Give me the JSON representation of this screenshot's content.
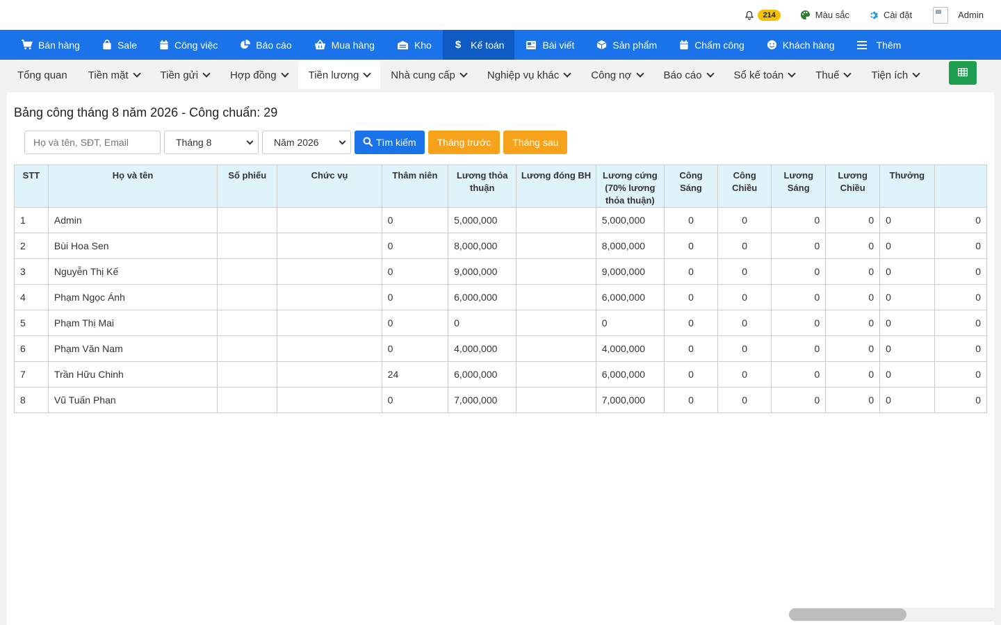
{
  "topbar": {
    "notification_count": "214",
    "color_label": "Màu sắc",
    "settings_label": "Cài đặt",
    "user_label": "Admin"
  },
  "mainnav": [
    {
      "label": "Bán hàng",
      "icon": "cart-icon"
    },
    {
      "label": "Sale",
      "icon": "bag-icon"
    },
    {
      "label": "Công việc",
      "icon": "calendar-icon"
    },
    {
      "label": "Báo cáo",
      "icon": "pie-chart-icon"
    },
    {
      "label": "Mua hàng",
      "icon": "basket-icon"
    },
    {
      "label": "Kho",
      "icon": "warehouse-icon"
    },
    {
      "label": "Kế toán",
      "icon": "dollar-icon",
      "active": true
    },
    {
      "label": "Bài viết",
      "icon": "newspaper-icon"
    },
    {
      "label": "Sản phẩm",
      "icon": "box-icon"
    },
    {
      "label": "Chấm công",
      "icon": "calendar-icon"
    },
    {
      "label": "Khách hàng",
      "icon": "smile-icon"
    },
    {
      "label": "Thêm",
      "icon": "menu-icon"
    }
  ],
  "subnav": [
    {
      "label": "Tổng quan",
      "dropdown": false
    },
    {
      "label": "Tiền mặt",
      "dropdown": true
    },
    {
      "label": "Tiền gửi",
      "dropdown": true
    },
    {
      "label": "Hợp đồng",
      "dropdown": true
    },
    {
      "label": "Tiền lương",
      "dropdown": true,
      "active": true
    },
    {
      "label": "Nhà cung cấp",
      "dropdown": true
    },
    {
      "label": "Nghiệp vụ khác",
      "dropdown": true
    },
    {
      "label": "Công nợ",
      "dropdown": true
    },
    {
      "label": "Báo cáo",
      "dropdown": true
    },
    {
      "label": "Sổ kế toán",
      "dropdown": true
    },
    {
      "label": "Thuế",
      "dropdown": true
    },
    {
      "label": "Tiện ích",
      "dropdown": true
    }
  ],
  "page": {
    "title": "Bảng công tháng 8 năm 2026 - Công chuẩn: 29"
  },
  "filters": {
    "search_placeholder": "Họ và tên, SĐT, Email",
    "month_value": "Tháng 8",
    "year_value": "Năm 2026",
    "search_button": "Tìm kiếm",
    "prev_button": "Tháng trước",
    "next_button": "Tháng sau"
  },
  "table": {
    "headers": [
      "STT",
      "Họ và tên",
      "Số phiếu",
      "Chức vụ",
      "Thâm niên",
      "Lương thỏa thuận",
      "Lương đóng BH",
      "Lương cứng (70% lương thỏa thuận)",
      "Công Sáng",
      "Công Chiều",
      "Lương Sáng",
      "Lương Chiều",
      "Thưởng",
      ""
    ],
    "rows": [
      [
        "1",
        "Admin",
        "",
        "",
        "0",
        "5,000,000",
        "",
        "5,000,000",
        "0",
        "0",
        "0",
        "0",
        "0",
        "0"
      ],
      [
        "2",
        "Bùi Hoa Sen",
        "",
        "",
        "0",
        "8,000,000",
        "",
        "8,000,000",
        "0",
        "0",
        "0",
        "0",
        "0",
        "0"
      ],
      [
        "3",
        "Nguyễn Thị Kế",
        "",
        "",
        "0",
        "9,000,000",
        "",
        "9,000,000",
        "0",
        "0",
        "0",
        "0",
        "0",
        "0"
      ],
      [
        "4",
        "Phạm Ngọc Ánh",
        "",
        "",
        "0",
        "6,000,000",
        "",
        "6,000,000",
        "0",
        "0",
        "0",
        "0",
        "0",
        "0"
      ],
      [
        "5",
        "Phạm Thị Mai",
        "",
        "",
        "0",
        "0",
        "",
        "0",
        "0",
        "0",
        "0",
        "0",
        "0",
        "0"
      ],
      [
        "6",
        "Phạm Văn Nam",
        "",
        "",
        "0",
        "4,000,000",
        "",
        "4,000,000",
        "0",
        "0",
        "0",
        "0",
        "0",
        "0"
      ],
      [
        "7",
        "Trần Hữu Chinh",
        "",
        "",
        "24",
        "6,000,000",
        "",
        "6,000,000",
        "0",
        "0",
        "0",
        "0",
        "0",
        "0"
      ],
      [
        "8",
        "Vũ Tuấn Phan",
        "",
        "",
        "0",
        "7,000,000",
        "",
        "7,000,000",
        "0",
        "0",
        "0",
        "0",
        "0",
        "0"
      ]
    ]
  },
  "colors": {
    "primary": "#1a73e8",
    "primary_active": "#0f5bc4",
    "orange": "#f7a21b",
    "green": "#1e9e4e",
    "header_bg": "#dff3fb",
    "badge": "#f5c000"
  }
}
